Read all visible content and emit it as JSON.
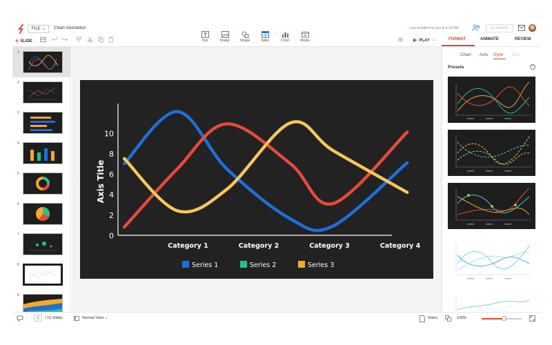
{
  "header": {
    "file_label": "FILE",
    "doc_title": "Chart Animation",
    "add_slide_label": "SLIDE",
    "insert_items": [
      {
        "label": "Text",
        "icon": "text-icon"
      },
      {
        "label": "Image",
        "icon": "image-icon"
      },
      {
        "label": "Shape",
        "icon": "shape-icon"
      },
      {
        "label": "Table",
        "icon": "table-icon"
      },
      {
        "label": "Chart",
        "icon": "chart-icon"
      },
      {
        "label": "Media",
        "icon": "media-icon"
      }
    ],
    "last_modified": "Last modified by you at 6:16 PM",
    "share_label": "SHARE",
    "play_label": "PLAY"
  },
  "right_tabs": {
    "format": "FORMAT",
    "animate": "ANIMATE",
    "review": "REVIEW",
    "active": "FORMAT"
  },
  "panel": {
    "subtabs": {
      "chart": "Chart",
      "axis": "Axis",
      "style": "Style",
      "text": "Text"
    },
    "active_subtab": "Style",
    "presets_title": "Presets"
  },
  "thumbnails": [
    {
      "number": "1"
    },
    {
      "number": "2"
    },
    {
      "number": "3"
    },
    {
      "number": "4"
    },
    {
      "number": "5"
    },
    {
      "number": "6"
    },
    {
      "number": "7"
    },
    {
      "number": "8"
    },
    {
      "number": "9"
    }
  ],
  "chart_data": {
    "type": "line",
    "categories": [
      "Category 1",
      "Category 2",
      "Category 3",
      "Category 4"
    ],
    "series": [
      {
        "name": "Series 1",
        "color": "#1e6fd9",
        "values": [
          7.0,
          12.1,
          6.5,
          1.6,
          0.9,
          7.1
        ]
      },
      {
        "name": "Series 2",
        "color": "#e84a3a",
        "values": [
          0.8,
          6.5,
          10.9,
          7.0,
          3.1,
          10.1
        ]
      },
      {
        "name": "Series 3",
        "color": "#f7c75a",
        "values": [
          7.5,
          2.4,
          4.5,
          11.0,
          8.3,
          4.2
        ]
      }
    ],
    "sample_x": [
      0.55,
      1.3,
      2.0,
      2.9,
      3.5,
      4.55
    ],
    "ylabel": "Axis Title",
    "yticks": [
      "0",
      "2",
      "4",
      "6",
      "8",
      "10"
    ],
    "ylim": [
      0,
      13
    ],
    "legend_position": "bottom",
    "legend_colors": [
      "#1e6fd9",
      "#1cc58d",
      "#f7a928"
    ]
  },
  "footer": {
    "page_number": "1",
    "page_total": "/ 10 Slides",
    "view_label": "Normal View",
    "notes_label": "Notes",
    "zoom_label": "100%",
    "zoom_level": 0.55
  },
  "colors": {
    "accent": "#e2452c",
    "slide_bg": "#222222"
  }
}
